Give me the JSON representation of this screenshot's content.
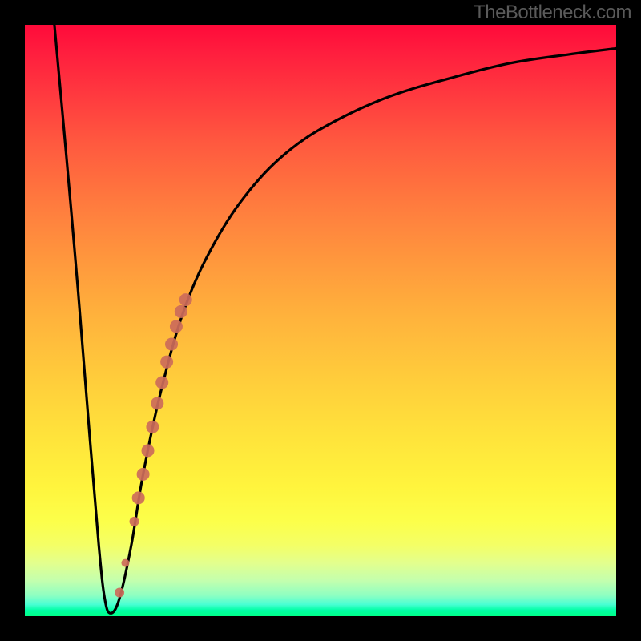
{
  "watermark": "TheBottleneck.com",
  "chart_data": {
    "type": "line",
    "title": "",
    "xlabel": "",
    "ylabel": "",
    "xlim": [
      0,
      100
    ],
    "ylim": [
      0,
      100
    ],
    "grid": false,
    "legend": false,
    "series": [
      {
        "name": "bottleneck-curve",
        "color": "#000000",
        "x": [
          5,
          7,
          9,
          11,
          12.5,
          13.5,
          14.5,
          16,
          18,
          20,
          23,
          27,
          32,
          38,
          45,
          53,
          62,
          72,
          82,
          92,
          100
        ],
        "y": [
          100,
          78,
          55,
          30,
          12,
          3,
          0.5,
          3,
          12,
          24,
          38,
          52,
          63,
          72,
          79,
          84,
          88,
          91,
          93.5,
          95,
          96
        ]
      },
      {
        "name": "highlight-dots",
        "color": "#cc6b5a",
        "type": "scatter",
        "points": [
          {
            "x": 16.0,
            "y": 4,
            "r": 6
          },
          {
            "x": 17.0,
            "y": 9,
            "r": 5
          },
          {
            "x": 18.5,
            "y": 16,
            "r": 6
          },
          {
            "x": 19.2,
            "y": 20,
            "r": 8
          },
          {
            "x": 20.0,
            "y": 24,
            "r": 8
          },
          {
            "x": 20.8,
            "y": 28,
            "r": 8
          },
          {
            "x": 21.6,
            "y": 32,
            "r": 8
          },
          {
            "x": 22.4,
            "y": 36,
            "r": 8
          },
          {
            "x": 23.2,
            "y": 39.5,
            "r": 8
          },
          {
            "x": 24.0,
            "y": 43,
            "r": 8
          },
          {
            "x": 24.8,
            "y": 46,
            "r": 8
          },
          {
            "x": 25.6,
            "y": 49,
            "r": 8
          },
          {
            "x": 26.4,
            "y": 51.5,
            "r": 8
          },
          {
            "x": 27.2,
            "y": 53.5,
            "r": 8
          }
        ]
      }
    ],
    "background_gradient": {
      "stops": [
        {
          "pos": 0,
          "color": "#ff0a3a"
        },
        {
          "pos": 50,
          "color": "#ffb43c"
        },
        {
          "pos": 85,
          "color": "#fcff4a"
        },
        {
          "pos": 100,
          "color": "#00ff88"
        }
      ]
    }
  }
}
